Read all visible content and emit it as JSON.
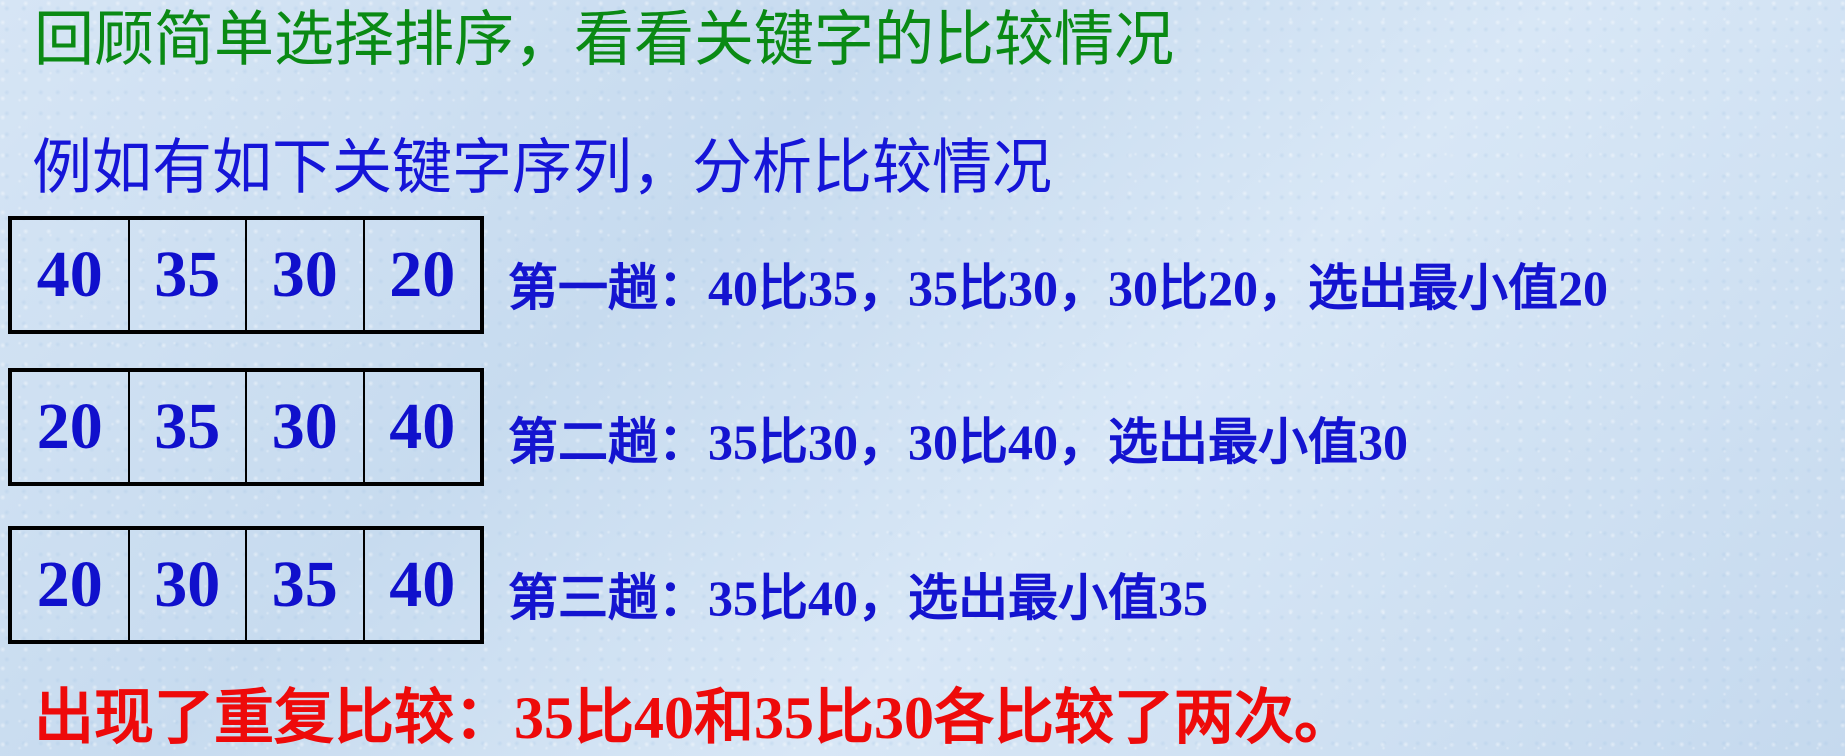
{
  "title": "回顾简单选择排序，看看关键字的比较情况",
  "subtitle": "例如有如下关键字序列，分析比较情况",
  "rows": [
    {
      "cells": [
        "40",
        "35",
        "30",
        "20"
      ],
      "description": "第一趟：40比35，35比30，30比20，选出最小值20"
    },
    {
      "cells": [
        "20",
        "35",
        "30",
        "40"
      ],
      "description": "第二趟：35比30，30比40，选出最小值30"
    },
    {
      "cells": [
        "20",
        "30",
        "35",
        "40"
      ],
      "description": "第三趟：35比40，选出最小值35"
    }
  ],
  "conclusion": "出现了重复比较：35比40和35比30各比较了两次。",
  "colors": {
    "title": "#0a8a14",
    "subtitle": "#1515d8",
    "cells": "#1010cc",
    "conclusion": "#ee0a0a"
  }
}
